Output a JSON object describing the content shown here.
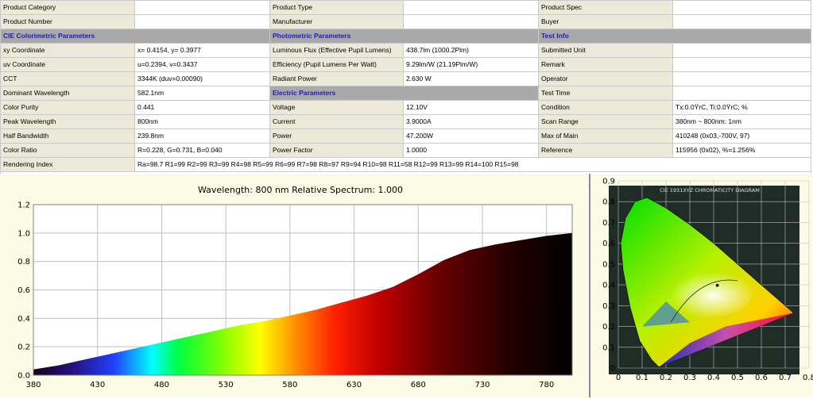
{
  "table": {
    "rows": [
      [
        {
          "t": "lbl",
          "name": "product-category-label",
          "v": "Product Category"
        },
        {
          "t": "val",
          "name": "product-category-value",
          "v": ""
        },
        {
          "t": "lbl",
          "name": "product-type-label",
          "v": "Product Type"
        },
        {
          "t": "val",
          "name": "product-type-value",
          "v": ""
        },
        {
          "t": "lbl",
          "name": "product-spec-label",
          "v": "Product Spec"
        },
        {
          "t": "val",
          "name": "product-spec-value",
          "v": ""
        }
      ],
      [
        {
          "t": "lbl",
          "name": "product-number-label",
          "v": "Product Number"
        },
        {
          "t": "val",
          "name": "product-number-value",
          "v": ""
        },
        {
          "t": "lbl",
          "name": "manufacturer-label",
          "v": "Manufacturer"
        },
        {
          "t": "val",
          "name": "manufacturer-value",
          "v": ""
        },
        {
          "t": "lbl",
          "name": "buyer-label",
          "v": "Buyer"
        },
        {
          "t": "val",
          "name": "buyer-value",
          "v": ""
        }
      ],
      [
        {
          "t": "sec",
          "name": "cie-section-header",
          "v": "CIE Colorimetric Parameters",
          "span": 2
        },
        {
          "t": "sec",
          "name": "photometric-section-header",
          "v": "Photometric Parameters",
          "span": 2
        },
        {
          "t": "sec",
          "name": "test-info-section-header",
          "v": "Test Info",
          "span": 2
        }
      ],
      [
        {
          "t": "lbl",
          "name": "xy-coordinate-label",
          "v": "xy Coordinate"
        },
        {
          "t": "val",
          "name": "xy-coordinate-value",
          "v": "x= 0.4154, y= 0.3977"
        },
        {
          "t": "lbl",
          "name": "luminous-flux-label",
          "v": "Luminous Flux (Effective Pupil Lumens)"
        },
        {
          "t": "val",
          "name": "luminous-flux-value",
          "v": "438.7lm (1000.2Plm)"
        },
        {
          "t": "lbl",
          "name": "submitted-unit-label",
          "v": "Submitted Unit"
        },
        {
          "t": "val",
          "name": "submitted-unit-value",
          "v": ""
        }
      ],
      [
        {
          "t": "lbl",
          "name": "uv-coordinate-label",
          "v": "uv Coordinate"
        },
        {
          "t": "val",
          "name": "uv-coordinate-value",
          "v": "u=0.2394, v=0.3437"
        },
        {
          "t": "lbl",
          "name": "efficiency-label",
          "v": "Efficiency (Pupil Lumens Per Watt)"
        },
        {
          "t": "val",
          "name": "efficiency-value",
          "v": "9.29lm/W (21.19Plm/W)"
        },
        {
          "t": "lbl",
          "name": "remark-label",
          "v": "Remark"
        },
        {
          "t": "val",
          "name": "remark-value",
          "v": ""
        }
      ],
      [
        {
          "t": "lbl",
          "name": "cct-label",
          "v": "CCT"
        },
        {
          "t": "val",
          "name": "cct-value",
          "v": "3344K (duv=0.00090)"
        },
        {
          "t": "lbl",
          "name": "radiant-power-label",
          "v": "Radiant Power"
        },
        {
          "t": "val",
          "name": "radiant-power-value",
          "v": "2.630 W"
        },
        {
          "t": "lbl",
          "name": "operator-label",
          "v": "Operator"
        },
        {
          "t": "val",
          "name": "operator-value",
          "v": ""
        }
      ],
      [
        {
          "t": "lbl",
          "name": "dominant-wavelength-label",
          "v": "Dominant Wavelength"
        },
        {
          "t": "val",
          "name": "dominant-wavelength-value",
          "v": "582.1nm"
        },
        {
          "t": "sec",
          "name": "electric-section-header",
          "v": "Electric Parameters",
          "span": 2
        },
        {
          "t": "lbl",
          "name": "test-time-label",
          "v": "Test Time"
        },
        {
          "t": "val",
          "name": "test-time-value",
          "v": ""
        }
      ],
      [
        {
          "t": "lbl",
          "name": "color-purity-label",
          "v": "Color Purity"
        },
        {
          "t": "val",
          "name": "color-purity-value",
          "v": "0.441"
        },
        {
          "t": "lbl",
          "name": "voltage-label",
          "v": "Voltage"
        },
        {
          "t": "val",
          "name": "voltage-value",
          "v": "12.10V"
        },
        {
          "t": "lbl",
          "name": "condition-label",
          "v": "Condition"
        },
        {
          "t": "val",
          "name": "condition-value",
          "v": "Tx:0.0ŸrC, Ti:0.0ŸrC; %"
        }
      ],
      [
        {
          "t": "lbl",
          "name": "peak-wavelength-label",
          "v": "Peak Wavelength"
        },
        {
          "t": "val",
          "name": "peak-wavelength-value",
          "v": "800nm"
        },
        {
          "t": "lbl",
          "name": "current-label",
          "v": "Current"
        },
        {
          "t": "val",
          "name": "current-value",
          "v": "3.9000A"
        },
        {
          "t": "lbl",
          "name": "scan-range-label",
          "v": "Scan Range"
        },
        {
          "t": "val",
          "name": "scan-range-value",
          "v": "380nm ~ 800nm: 1nm"
        }
      ],
      [
        {
          "t": "lbl",
          "name": "half-bandwidth-label",
          "v": "Half Bandwidth"
        },
        {
          "t": "val",
          "name": "half-bandwidth-value",
          "v": "239.8nm"
        },
        {
          "t": "lbl",
          "name": "power-label",
          "v": "Power"
        },
        {
          "t": "val",
          "name": "power-value",
          "v": "47.200W"
        },
        {
          "t": "lbl",
          "name": "max-of-main-label",
          "v": "Max of Main"
        },
        {
          "t": "val",
          "name": "max-of-main-value",
          "v": "410248 (0x03,-700V, 97)"
        }
      ],
      [
        {
          "t": "lbl",
          "name": "color-ratio-label",
          "v": "Color Ratio"
        },
        {
          "t": "val",
          "name": "color-ratio-value",
          "v": "R=0.228, G=0.731, B=0.040"
        },
        {
          "t": "lbl",
          "name": "power-factor-label",
          "v": "Power Factor"
        },
        {
          "t": "val",
          "name": "power-factor-value",
          "v": "1.0000"
        },
        {
          "t": "lbl",
          "name": "reference-label",
          "v": "Reference"
        },
        {
          "t": "val",
          "name": "reference-value",
          "v": "115956 (0x02), %=1.256%"
        }
      ],
      [
        {
          "t": "lbl",
          "name": "rendering-index-label",
          "v": "Rendering Index"
        },
        {
          "t": "val",
          "name": "rendering-index-value",
          "v": "Ra=98.7  R1=99 R2=99 R3=99 R4=98 R5=99 R6=99 R7=98 R8=97 R9=94 R10=98 R11=58 R12=99 R13=99 R14=100 R15=98",
          "span": 5
        }
      ],
      [
        {
          "t": "blank",
          "name": "table-blank-row",
          "v": "",
          "span": 6
        }
      ]
    ]
  },
  "spectrum": {
    "header": "Wavelength: 800 nm   Relative Spectrum: 1.000"
  },
  "chart_data": [
    {
      "type": "area",
      "title": "Wavelength: 800 nm   Relative Spectrum: 1.000",
      "xlabel": "",
      "ylabel": "",
      "xlim": [
        380,
        800
      ],
      "ylim": [
        0,
        1.2
      ],
      "x_ticks": [
        380,
        430,
        480,
        530,
        580,
        630,
        680,
        730,
        780
      ],
      "y_ticks": [
        0.0,
        0.2,
        0.4,
        0.6,
        0.8,
        1.0,
        1.2
      ],
      "grid": true,
      "series": [
        {
          "x": [
            380,
            400,
            420,
            440,
            460,
            480,
            500,
            520,
            540,
            560,
            580,
            600,
            620,
            640,
            660,
            680,
            700,
            720,
            740,
            760,
            780,
            800
          ],
          "values": [
            0.04,
            0.07,
            0.11,
            0.15,
            0.19,
            0.23,
            0.27,
            0.31,
            0.35,
            0.38,
            0.42,
            0.46,
            0.51,
            0.56,
            0.62,
            0.71,
            0.81,
            0.88,
            0.92,
            0.95,
            0.98,
            1.0
          ]
        }
      ]
    },
    {
      "type": "scatter",
      "title": "CIE 1931XYZ CHROMATICITY DIAGRAM",
      "xlabel": "",
      "ylabel": "",
      "xlim": [
        0,
        0.8
      ],
      "ylim": [
        0,
        0.9
      ],
      "x_ticks": [
        0,
        0.1,
        0.2,
        0.3,
        0.4,
        0.5,
        0.6,
        0.7,
        0.8
      ],
      "y_ticks": [
        0,
        0.1,
        0.2,
        0.3,
        0.4,
        0.5,
        0.6,
        0.7,
        0.8,
        0.9
      ],
      "grid": true,
      "series": [
        {
          "x": [
            0.4154
          ],
          "values": [
            0.3977
          ]
        }
      ]
    }
  ],
  "colors": {
    "label_bg": "#ece9d8",
    "section_bg": "#a9a9a9",
    "section_text": "#1a1acd",
    "plot_bg": "#fcfce6",
    "diagram_bg": "#1f2d26"
  }
}
